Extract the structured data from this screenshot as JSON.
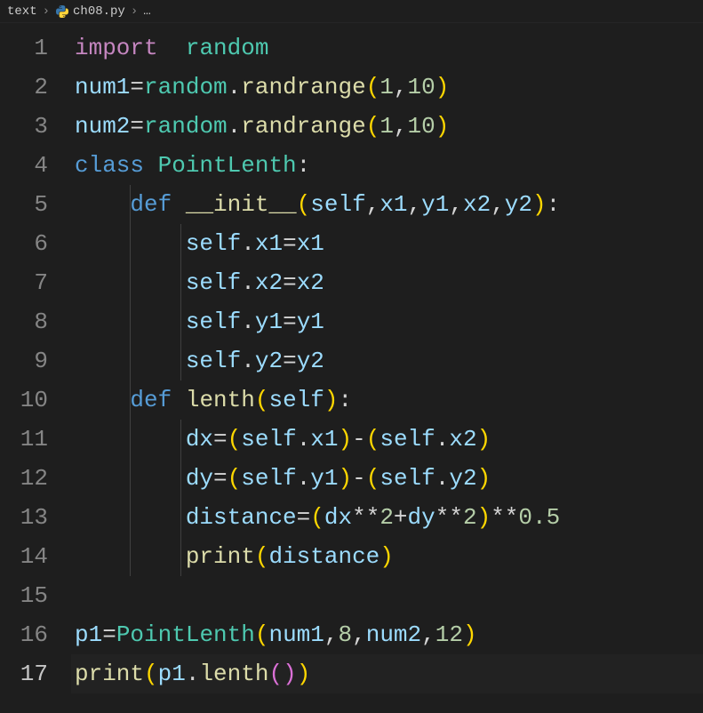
{
  "breadcrumb": {
    "part1": "text",
    "sep": "›",
    "file": "ch08.py",
    "part3": "…"
  },
  "gutter": {
    "lines": [
      "1",
      "2",
      "3",
      "4",
      "5",
      "6",
      "7",
      "8",
      "9",
      "10",
      "11",
      "12",
      "13",
      "14",
      "15",
      "16",
      "17"
    ],
    "current": 17
  },
  "code": {
    "l1": {
      "kw": "import",
      "sp": "  ",
      "mod": "random"
    },
    "l2": {
      "v": "num1",
      "eq": "=",
      "mod": "random",
      "dot": ".",
      "fn": "randrange",
      "lp": "(",
      "n1": "1",
      "c": ",",
      "n2": "10",
      "rp": ")"
    },
    "l3": {
      "v": "num2",
      "eq": "=",
      "mod": "random",
      "dot": ".",
      "fn": "randrange",
      "lp": "(",
      "n1": "1",
      "c": ",",
      "n2": "10",
      "rp": ")"
    },
    "l4": {
      "kw": "class",
      "sp": " ",
      "cls": "PointLenth",
      "colon": ":"
    },
    "l5": {
      "indent": "    ",
      "kw": "def",
      "sp": " ",
      "fn": "__init__",
      "lp": "(",
      "self": "self",
      "c": ",",
      "a1": "x1",
      "a2": "y1",
      "a3": "x2",
      "a4": "y2",
      "rp": ")",
      "colon": ":"
    },
    "l6": {
      "indent": "        ",
      "self": "self",
      "dot": ".",
      "attr": "x1",
      "eq": "=",
      "rhs": "x1"
    },
    "l7": {
      "indent": "        ",
      "self": "self",
      "dot": ".",
      "attr": "x2",
      "eq": "=",
      "rhs": "x2"
    },
    "l8": {
      "indent": "        ",
      "self": "self",
      "dot": ".",
      "attr": "y1",
      "eq": "=",
      "rhs": "y1"
    },
    "l9": {
      "indent": "        ",
      "self": "self",
      "dot": ".",
      "attr": "y2",
      "eq": "=",
      "rhs": "y2"
    },
    "l10": {
      "indent": "    ",
      "kw": "def",
      "sp": " ",
      "fn": "lenth",
      "lp": "(",
      "self": "self",
      "rp": ")",
      "colon": ":"
    },
    "l11": {
      "indent": "        ",
      "v": "dx",
      "eq": "=",
      "lp1": "(",
      "self1": "self",
      "dot": ".",
      "a1": "x1",
      "rp1": ")",
      "minus": "-",
      "lp2": "(",
      "self2": "self",
      "a2": "x2",
      "rp2": ")"
    },
    "l12": {
      "indent": "        ",
      "v": "dy",
      "eq": "=",
      "lp1": "(",
      "self1": "self",
      "dot": ".",
      "a1": "y1",
      "rp1": ")",
      "minus": "-",
      "lp2": "(",
      "self2": "self",
      "a2": "y2",
      "rp2": ")"
    },
    "l13": {
      "indent": "        ",
      "v": "distance",
      "eq": "=",
      "lp": "(",
      "v1": "dx",
      "pow": "**",
      "n2": "2",
      "plus": "+",
      "v2": "dy",
      "rp": ")",
      "n05": "0.5"
    },
    "l14": {
      "indent": "        ",
      "fn": "print",
      "lp": "(",
      "arg": "distance",
      "rp": ")"
    },
    "l15": {
      "blank": ""
    },
    "l16": {
      "v": "p1",
      "eq": "=",
      "cls": "PointLenth",
      "lp": "(",
      "a1": "num1",
      "c": ",",
      "n1": "8",
      "a2": "num2",
      "n2": "12",
      "rp": ")"
    },
    "l17": {
      "fn": "print",
      "lp": "(",
      "v": "p1",
      "dot": ".",
      "m": "lenth",
      "lp2": "(",
      "rp2": ")",
      "rp": ")"
    }
  }
}
